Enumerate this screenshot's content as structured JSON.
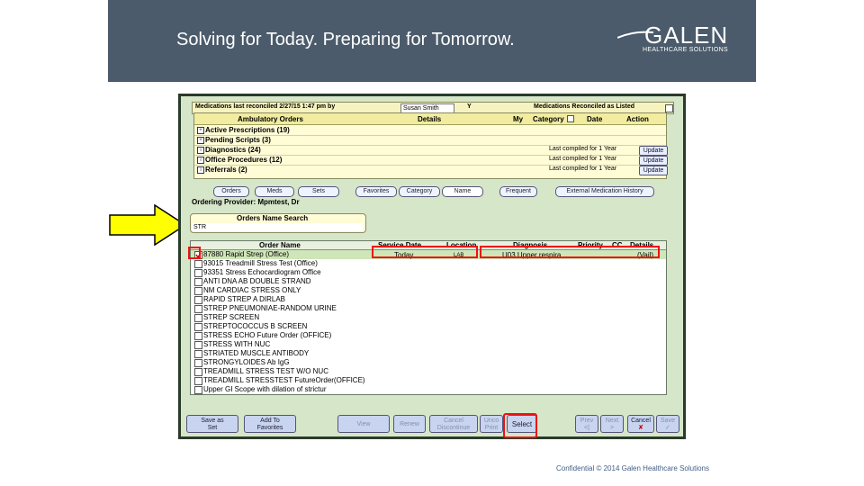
{
  "header": {
    "tagline": "Solving for Today. Preparing for Tomorrow.",
    "logo_name": "GALEN",
    "logo_sub": "HEALTHCARE SOLUTIONS"
  },
  "footer": {
    "text": "Confidential © 2014 Galen Healthcare Solutions"
  },
  "app": {
    "topbar": {
      "left_text": "Medications last reconciled 2/27/15 1:47 pm by",
      "patient_name": "Susan Smith",
      "field_y": "Y",
      "right_text": "Medications Reconciled as Listed"
    },
    "panel": {
      "headers": [
        "Ambulatory Orders",
        "Details",
        "My",
        "Category",
        "Date",
        "Action"
      ],
      "rows": [
        {
          "label": "Active Prescriptions (19)",
          "compiled": "",
          "button": ""
        },
        {
          "label": "Pending Scripts (3)",
          "compiled": "",
          "button": ""
        },
        {
          "label": "Diagnostics (24)",
          "compiled": "Last compiled for 1 Year",
          "button": "Update"
        },
        {
          "label": "Office Procedures (12)",
          "compiled": "Last compiled for 1 Year",
          "button": "Update"
        },
        {
          "label": "Referrals (2)",
          "compiled": "Last compiled for 1 Year",
          "button": "Update"
        }
      ]
    },
    "tabs": [
      "Orders",
      "Meds",
      "Sets",
      "Favorites",
      "Category",
      "Name",
      "Frequent",
      "External Medication History"
    ],
    "ordering_provider": "Ordering Provider: Mpmtest, Dr",
    "search": {
      "label": "Orders Name Search",
      "value": "STR"
    },
    "grid": {
      "columns": [
        "Order Name",
        "Service Date",
        "Location",
        "Diagnosis",
        "Priority",
        "CC",
        "Details"
      ],
      "selected_row": {
        "service_date": "Today",
        "location": "LAB",
        "diagnosis": "U03 Upper respira...",
        "details": "(Vail)"
      },
      "rows": [
        "87880 Rapid Strep (Office)",
        "93015 Treadmill Stress Test (Office)",
        "93351 Stress Echocardiogram Office",
        "ANTI DNA AB DOUBLE STRAND",
        "NM CARDIAC STRESS ONLY",
        "RAPID STREP A DIRLAB",
        "STREP PNEUMONIAE-RANDOM URINE",
        "STREP SCREEN",
        "STREPTOCOCCUS B SCREEN",
        "STRESS ECHO Future Order (OFFICE)",
        "STRESS WITH NUC",
        "STRIATED MUSCLE ANTIBODY",
        "STRONGYLOIDES Ab IgG",
        "TREADMILL STRESS TEST W/O NUC",
        "TREADMILL STRESSTEST FutureOrder(OFFICE)",
        "Upper GI Scope with dilation of strictur"
      ]
    },
    "buttons": {
      "save_as_set": [
        "Save as",
        "Set"
      ],
      "add_to_favorites": [
        "Add To",
        "Favorites"
      ],
      "view": "View",
      "renew": "Renew",
      "cancel_discontinue": [
        "Cancel",
        "Discontinue"
      ],
      "unco_print": [
        "Unco",
        "Print"
      ],
      "select": "Select",
      "prev": [
        "Prev",
        "<|"
      ],
      "next": [
        "Next",
        ">"
      ],
      "cancel": [
        "Cancel",
        "✘"
      ],
      "save": [
        "Save",
        "✓"
      ]
    }
  },
  "colors": {
    "banner": "#4b5b6b",
    "app_bg": "#d6e6c9",
    "highlight": "#e11111",
    "arrow": "#ffff00"
  }
}
